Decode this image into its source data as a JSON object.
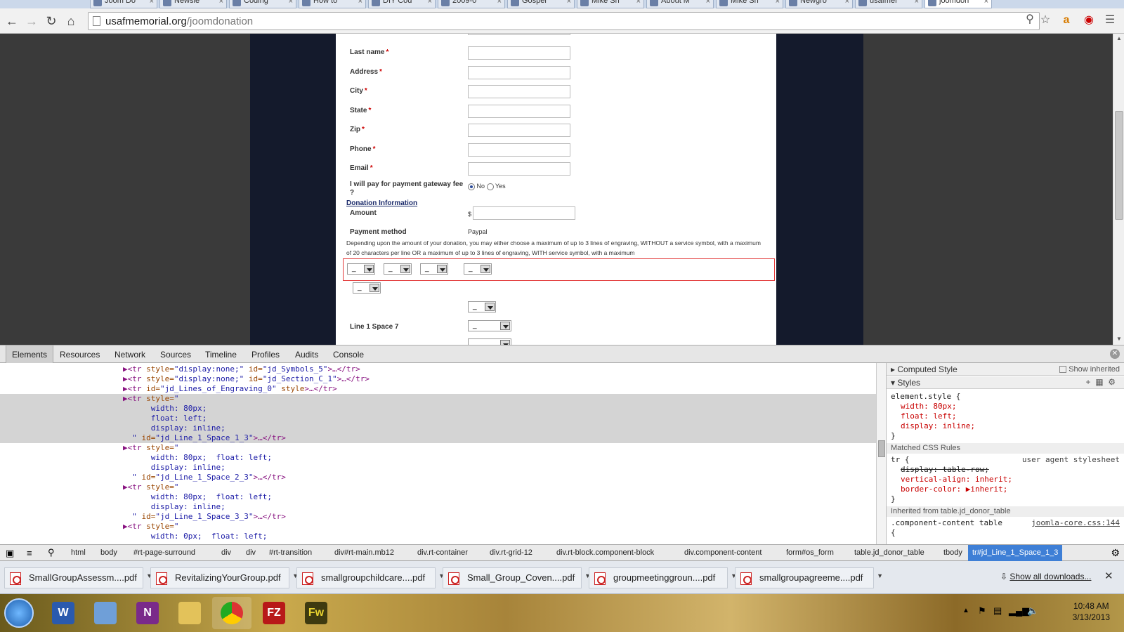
{
  "browser": {
    "tabs": [
      "Joom Do",
      "Newsle",
      "Coding",
      "How to",
      "DIY Cod",
      "2009-0",
      "Gospel",
      "Mike Sh",
      "About M",
      "Mike Sh",
      "Newgro",
      "usafmer",
      "joomdon"
    ],
    "url_host": "usafmemorial.org",
    "url_path": "/joomdonation"
  },
  "form": {
    "fields": [
      {
        "label": "Last name",
        "req": "*"
      },
      {
        "label": "Address",
        "req": "*"
      },
      {
        "label": "City",
        "req": "*"
      },
      {
        "label": "State",
        "req": "*"
      },
      {
        "label": "Zip",
        "req": "*"
      },
      {
        "label": "Phone",
        "req": "*"
      },
      {
        "label": "Email",
        "req": "*"
      }
    ],
    "gateway_fee_label": "I will pay for payment gateway fee ?",
    "gateway_no": "No",
    "gateway_yes": "Yes",
    "donation_section_title": "Donation Information",
    "amount_label": "Amount",
    "currency": "$",
    "payment_method_label": "Payment method",
    "payment_method_value": "Paypal",
    "engraving_note_1": "Depending upon the amount of your donation, you may either choose a maximum of up to 3 lines of engraving, WITHOUT a service symbol, with a maximum",
    "engraving_note_2": "of 20 characters per line OR a maximum of up to 3 lines of engraving, WITH service symbol, with a maximum",
    "select_placeholder": "_",
    "line1_space7_label": "Line 1 Space 7"
  },
  "devtools": {
    "tabs": [
      "Elements",
      "Resources",
      "Network",
      "Sources",
      "Timeline",
      "Profiles",
      "Audits",
      "Console"
    ],
    "dom_lines": [
      {
        "a": "▶<tr ",
        "b": "style=",
        "c": "\"display:none;\"",
        "d": " id=",
        "e": "\"jd_Symbols_5\"",
        "f": ">…</tr>"
      },
      {
        "a": "▶<tr ",
        "b": "style=",
        "c": "\"display:none;\"",
        "d": " id=",
        "e": "\"jd_Section_C_1\"",
        "f": ">…</tr>"
      },
      {
        "a": "▶<tr ",
        "b": "id=",
        "c": "\"jd_Lines_of_Engraving_0\"",
        "d": " style",
        "e": "",
        "f": ">…</tr>"
      },
      {
        "a": "▶<tr ",
        "b": "style=",
        "c": "\"",
        "d": "",
        "e": "",
        "f": ""
      },
      {
        "a": "      ",
        "b": "",
        "c": "width: 80px;",
        "d": "",
        "e": "",
        "f": ""
      },
      {
        "a": "      ",
        "b": "",
        "c": "float: left;",
        "d": "",
        "e": "",
        "f": ""
      },
      {
        "a": "      ",
        "b": "",
        "c": "display: inline;",
        "d": "",
        "e": "",
        "f": ""
      },
      {
        "a": "  ",
        "b": "",
        "c": "\" ",
        "d": "id=",
        "e": "\"jd_Line_1_Space_1_3\"",
        "f": ">…</tr>"
      },
      {
        "a": "▶<tr ",
        "b": "style=",
        "c": "\"",
        "d": "",
        "e": "",
        "f": ""
      },
      {
        "a": "      ",
        "b": "",
        "c": "width: 80px;  float: left;",
        "d": "",
        "e": "",
        "f": ""
      },
      {
        "a": "      ",
        "b": "",
        "c": "display: inline;",
        "d": "",
        "e": "",
        "f": ""
      },
      {
        "a": "  ",
        "b": "",
        "c": "\" ",
        "d": "id=",
        "e": "\"jd_Line_1_Space_2_3\"",
        "f": ">…</tr>"
      },
      {
        "a": "▶<tr ",
        "b": "style=",
        "c": "\"",
        "d": "",
        "e": "",
        "f": ""
      },
      {
        "a": "      ",
        "b": "",
        "c": "width: 80px;  float: left;",
        "d": "",
        "e": "",
        "f": ""
      },
      {
        "a": "      ",
        "b": "",
        "c": "display: inline;",
        "d": "",
        "e": "",
        "f": ""
      },
      {
        "a": "  ",
        "b": "",
        "c": "\" ",
        "d": "id=",
        "e": "\"jd_Line_1_Space_3_3\"",
        "f": ">…</tr>"
      },
      {
        "a": "▶<tr ",
        "b": "style=",
        "c": "\"",
        "d": "",
        "e": "",
        "f": ""
      },
      {
        "a": "      ",
        "b": "",
        "c": "width: 0px;  float: left;",
        "d": "",
        "e": "",
        "f": ""
      }
    ],
    "computed_style_label": "Computed Style",
    "show_inherited_label": "Show inherited",
    "styles_label": "Styles",
    "element_style_selector": "element.style {",
    "element_style_rules": [
      "width: 80px;",
      "float: left;",
      "display: inline;"
    ],
    "matched_rules_label": "Matched CSS Rules",
    "tr_selector": "tr {",
    "ua_label": "user agent stylesheet",
    "tr_rules": [
      "display: table-row;",
      "vertical-align: inherit;",
      "border-color: ▶inherit;"
    ],
    "inherited_label": "Inherited from table.jd_donor_table",
    "inherited_selector": ".component-content table",
    "inherited_source": "joomla-core.css:144",
    "open_brace": "{",
    "close_brace": "}",
    "breadcrumbs": [
      "html",
      "body",
      "#rt-page-surround",
      "div",
      "div",
      "#rt-transition",
      "div#rt-main.mb12",
      "div.rt-container",
      "div.rt-grid-12",
      "div.rt-block.component-block",
      "div.component-content",
      "form#os_form",
      "table.jd_donor_table",
      "tbody",
      "tr#jd_Line_1_Space_1_3"
    ]
  },
  "downloads": {
    "items": [
      "SmallGroupAssessm....pdf",
      "RevitalizingYourGroup.pdf",
      "smallgroupchildcare....pdf",
      "Small_Group_Coven....pdf",
      "groupmeetinggroun....pdf",
      "smallgroupagreeme....pdf"
    ],
    "show_all": "Show all downloads..."
  },
  "taskbar": {
    "apps": [
      "W",
      "N",
      "FZ",
      "Fw"
    ],
    "time": "10:48 AM",
    "date": "3/13/2013"
  }
}
